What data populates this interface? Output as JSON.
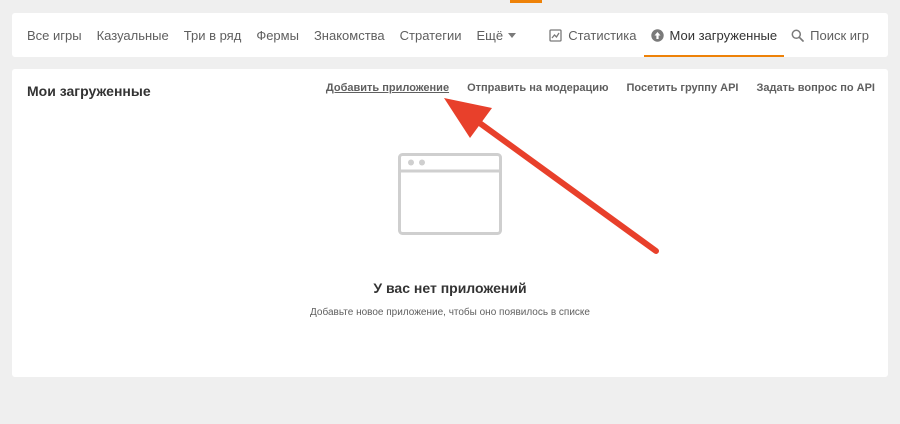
{
  "nav": {
    "left_items": [
      "Все игры",
      "Казуальные",
      "Три в ряд",
      "Фермы",
      "Знакомства",
      "Стратегии"
    ],
    "more_label": "Ещё",
    "tabs": {
      "stats": "Статистика",
      "uploaded": "Мои загруженные",
      "search": "Поиск игр"
    },
    "active_tab": "uploaded"
  },
  "panel": {
    "title": "Мои загруженные",
    "actions": {
      "add_app": "Добавить приложение",
      "send_moderation": "Отправить на модерацию",
      "visit_api_group": "Посетить группу API",
      "ask_api": "Задать вопрос по API"
    },
    "empty_state": {
      "title": "У вас нет приложений",
      "subtitle": "Добавьте новое приложение, чтобы оно появилось в списке"
    }
  },
  "colors": {
    "accent": "#ee8208",
    "annotation_arrow": "#e8402b",
    "background": "#efefef"
  },
  "icons": {
    "stats": "chart-icon",
    "uploaded": "upload-circle-icon",
    "search": "search-icon",
    "more": "caret-down-icon",
    "empty": "browser-window-icon",
    "annotation": "red-arrow"
  }
}
